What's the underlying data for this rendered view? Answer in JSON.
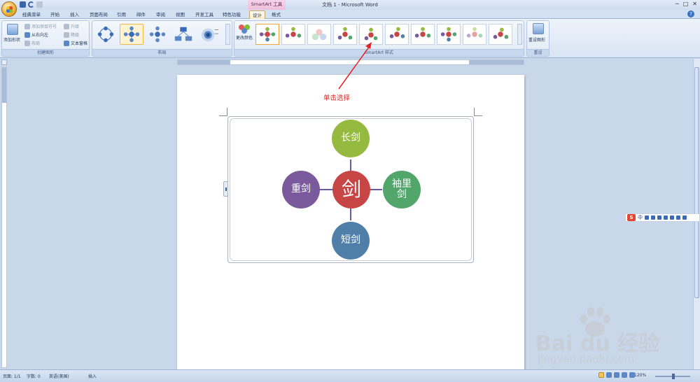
{
  "window": {
    "title": "文档 1 - Microsoft Word",
    "context_tool_title": "SmartArt 工具"
  },
  "tabs": [
    {
      "label": "经典菜单"
    },
    {
      "label": "开始"
    },
    {
      "label": "插入"
    },
    {
      "label": "页面布局"
    },
    {
      "label": "引用"
    },
    {
      "label": "邮件"
    },
    {
      "label": "审阅"
    },
    {
      "label": "视图"
    },
    {
      "label": "开发工具"
    },
    {
      "label": "特色功能"
    },
    {
      "label": "设计",
      "active": true
    },
    {
      "label": "格式"
    }
  ],
  "ribbon": {
    "create_graphic": {
      "label": "创建图形",
      "add_shape": "添加形状",
      "add_bullet": "添加项目符号",
      "right_to_left": "从右向左",
      "layout": "布局",
      "promote": "升级",
      "demote": "降级",
      "text_pane": "文本窗格"
    },
    "layouts": {
      "label": "布局",
      "selected_index": 1
    },
    "styles": {
      "label": "SmartArt 样式",
      "change_colors": "更改颜色",
      "selected_index": 0
    },
    "reset": {
      "label": "重设",
      "reset_graphic": "重设图形"
    }
  },
  "smartart": {
    "center": {
      "text": "剑",
      "color": "#c84545"
    },
    "nodes": [
      {
        "position": "top",
        "text": "长剑",
        "color": "#96b93f"
      },
      {
        "position": "right",
        "text": "袖里剑",
        "color": "#52a56b"
      },
      {
        "position": "bottom",
        "text": "短剑",
        "color": "#4f7fa8"
      },
      {
        "position": "left",
        "text": "重剑",
        "color": "#7a5a9c"
      }
    ],
    "connector_color": "#6a5a9a"
  },
  "annotation": {
    "text": "单击选择",
    "color": "#e02424"
  },
  "statusbar": {
    "page": "页面: 1/1",
    "words": "字数: 0",
    "language": "英语(美国)",
    "mode": "插入",
    "zoom": "120%"
  },
  "ime": {
    "logo": "S",
    "mode": "中"
  },
  "watermark": {
    "brand": "Bai du 经验",
    "url": "jingyan.baidu.com"
  }
}
